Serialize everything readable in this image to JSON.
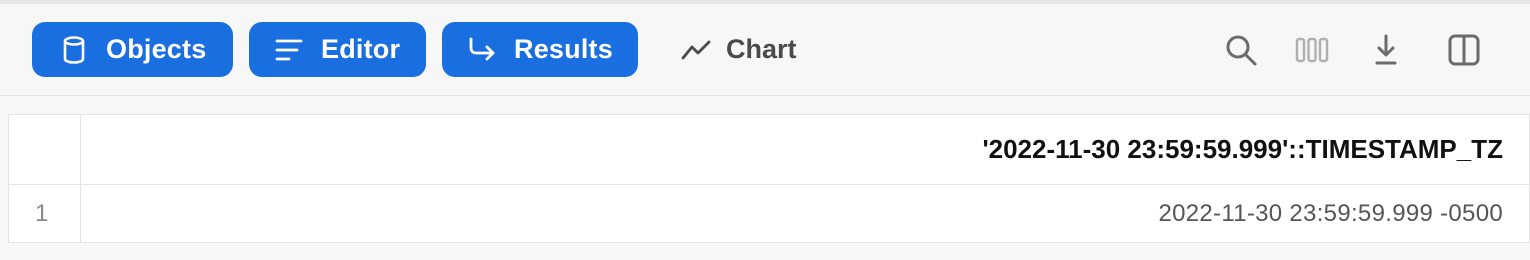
{
  "toolbar": {
    "objects_label": "Objects",
    "editor_label": "Editor",
    "results_label": "Results",
    "chart_label": "Chart",
    "icons": {
      "objects": "database-icon",
      "editor": "lines-icon",
      "results": "return-arrow-icon",
      "chart": "line-chart-icon",
      "search": "search-icon",
      "columns": "columns-icon",
      "download": "download-icon",
      "panel": "split-panel-icon"
    },
    "colors": {
      "accent": "#1a6fe0",
      "icon_gray": "#6b6b6b"
    }
  },
  "results_table": {
    "columns": [
      "'2022-11-30 23:59:59.999'::TIMESTAMP_TZ"
    ],
    "rows": [
      {
        "index": "1",
        "values": [
          "2022-11-30 23:59:59.999 -0500"
        ]
      }
    ]
  }
}
